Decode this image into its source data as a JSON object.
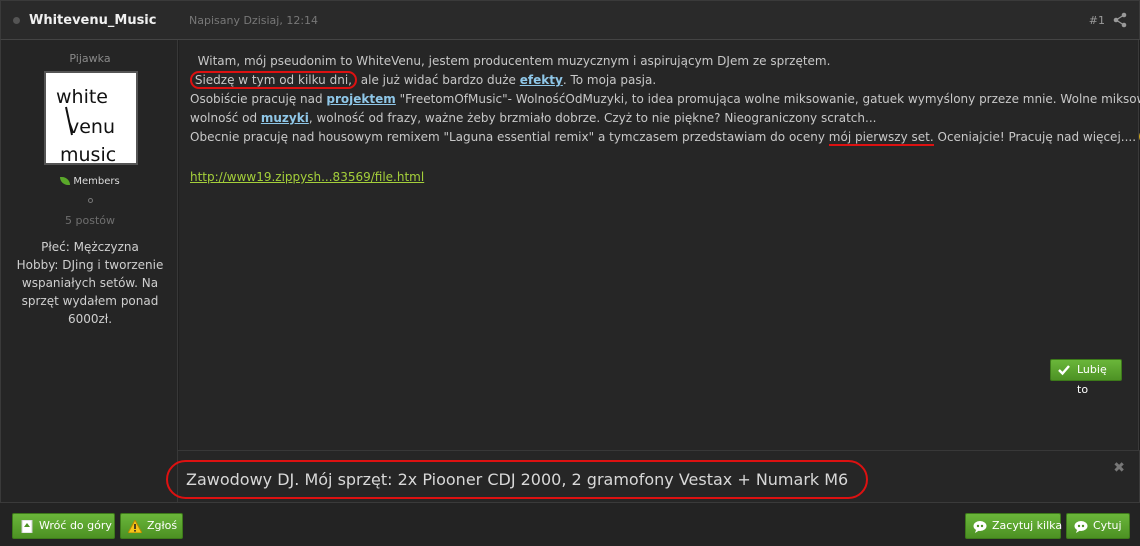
{
  "post": {
    "author": "Whitevenu_Music",
    "date": "Napisany Dzisiaj, 12:14",
    "number": "#1"
  },
  "author_panel": {
    "rank": "Pijawka",
    "avatar_text": [
      "white",
      "venu",
      "music"
    ],
    "group": "Members",
    "post_count": "5 postów",
    "fields": [
      "Płeć: Mężczyzna",
      "Hobby: DJing i tworzenie wspaniałych setów. Na sprzęt wydałem ponad 6000zł."
    ]
  },
  "content": {
    "line1": "Witam, mój pseudonim to WhiteVenu, jestem producentem muzycznym i aspirującym DJem ze sprzętem.",
    "line2_circled": "Siedzę w tym od kilku dni,",
    "line2_rest_a": " ale już widać bardzo duże ",
    "line2_link": "efekty",
    "line2_rest_b": ". To moja pasja.",
    "line3_a": "Osobiście pracuję nad ",
    "line3_link": "projektem",
    "line3_b": " \"FreetomOfMusic\"- WolnośćOdMuzyki, to idea promująca wolne miksowanie, gatuek wymyślony przeze mnie. Wolne miksowanie-",
    "line4_a": "wolność od ",
    "line4_link": "muzyki",
    "line4_b": ", wolność od frazy, ważne żeby brzmiało dobrze. Czyż to nie piękne? Nieograniczony scratch...",
    "line5_a": "Obecnie pracuję nad housowym remixem \"Laguna essential remix\" a tymczasem przedstawiam do oceny ",
    "line5_underlined": "mój pierwszy set.",
    "line5_b": " Oceniajcie! Pracuję nad więcej....",
    "file_link": "http://www19.zippysh...83569/file.html"
  },
  "like_label": "Lubię to",
  "signature": "Zawodowy DJ.  Mój sprzęt: 2x Piooner CDJ 2000, 2 gramofony Vestax + Numark M6",
  "signature_close": "✖",
  "footer": {
    "back_to_top": "Wróć do góry",
    "report": "Zgłoś",
    "multi_quote": "Zacytuj kilka",
    "quote": "Cytuj"
  },
  "colors": {
    "accent_green": "#5aa82a",
    "link_blue": "#8fc7e8",
    "link_green": "#a4cf3a",
    "annotation_red": "#dd1111"
  }
}
